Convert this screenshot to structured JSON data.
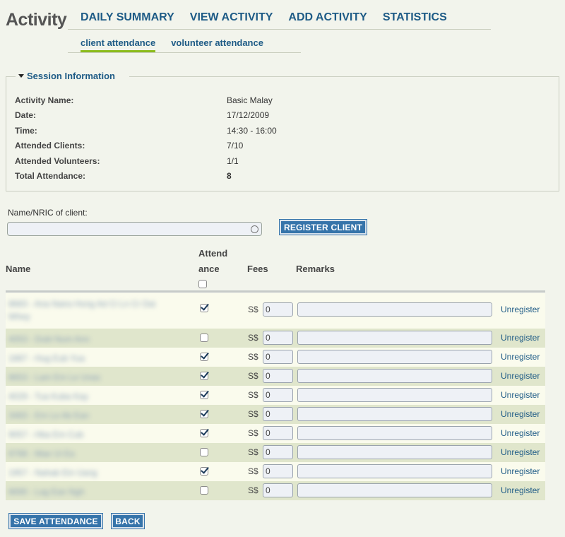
{
  "page": {
    "title": "Activity"
  },
  "main_nav": [
    {
      "label": "DAILY SUMMARY"
    },
    {
      "label": "VIEW ACTIVITY"
    },
    {
      "label": "ADD ACTIVITY"
    },
    {
      "label": "STATISTICS"
    }
  ],
  "sub_nav": [
    {
      "label": "client attendance",
      "active": true
    },
    {
      "label": "volunteer attendance",
      "active": false
    }
  ],
  "session": {
    "legend": "Session Information",
    "fields": [
      {
        "label": "Activity Name:",
        "value": "Basic Malay"
      },
      {
        "label": "Date:",
        "value": "17/12/2009"
      },
      {
        "label": "Time:",
        "value": "14:30 - 16:00"
      },
      {
        "label": "Attended Clients:",
        "value": "7/10"
      },
      {
        "label": "Attended Volunteers:",
        "value": "1/1"
      },
      {
        "label": "Total Attendance:",
        "value": "8"
      }
    ]
  },
  "search": {
    "label": "Name/NRIC of client:",
    "value": "",
    "register_button": "REGISTER CLIENT"
  },
  "table": {
    "headers": {
      "name": "Name",
      "attendance_line1": "Attend",
      "attendance_line2": "ance",
      "fees": "Fees",
      "remarks": "Remarks"
    },
    "select_all_checked": false,
    "currency": "S$",
    "unregister_label": "Unregister",
    "rows": [
      {
        "name": "8683 - Ana Naira Hong Ad Ci Ln Cr Dai Whey",
        "attended": true,
        "fee": "0",
        "remarks": ""
      },
      {
        "name": "4053 - Dubi Num Ann",
        "attended": false,
        "fee": "0",
        "remarks": ""
      },
      {
        "name": "1887 - Hug Eub Yua",
        "attended": true,
        "fee": "0",
        "remarks": ""
      },
      {
        "name": "8653 - Lam Em Le Unas",
        "attended": true,
        "fee": "0",
        "remarks": ""
      },
      {
        "name": "4029 - Tua Kuba Kay",
        "attended": true,
        "fee": "0",
        "remarks": ""
      },
      {
        "name": "3483 - Em Le Ab Ean",
        "attended": true,
        "fee": "0",
        "remarks": ""
      },
      {
        "name": "9057 - Hba Em Cub",
        "attended": true,
        "fee": "0",
        "remarks": ""
      },
      {
        "name": "8768 - Mae Ui Ea",
        "attended": false,
        "fee": "0",
        "remarks": ""
      },
      {
        "name": "1957 - Nahab Ein Uang",
        "attended": true,
        "fee": "0",
        "remarks": ""
      },
      {
        "name": "8690 - Lag Ean Ngh",
        "attended": false,
        "fee": "0",
        "remarks": ""
      }
    ]
  },
  "actions": {
    "save_label": "SAVE ATTENDANCE",
    "back_label": "BACK"
  }
}
